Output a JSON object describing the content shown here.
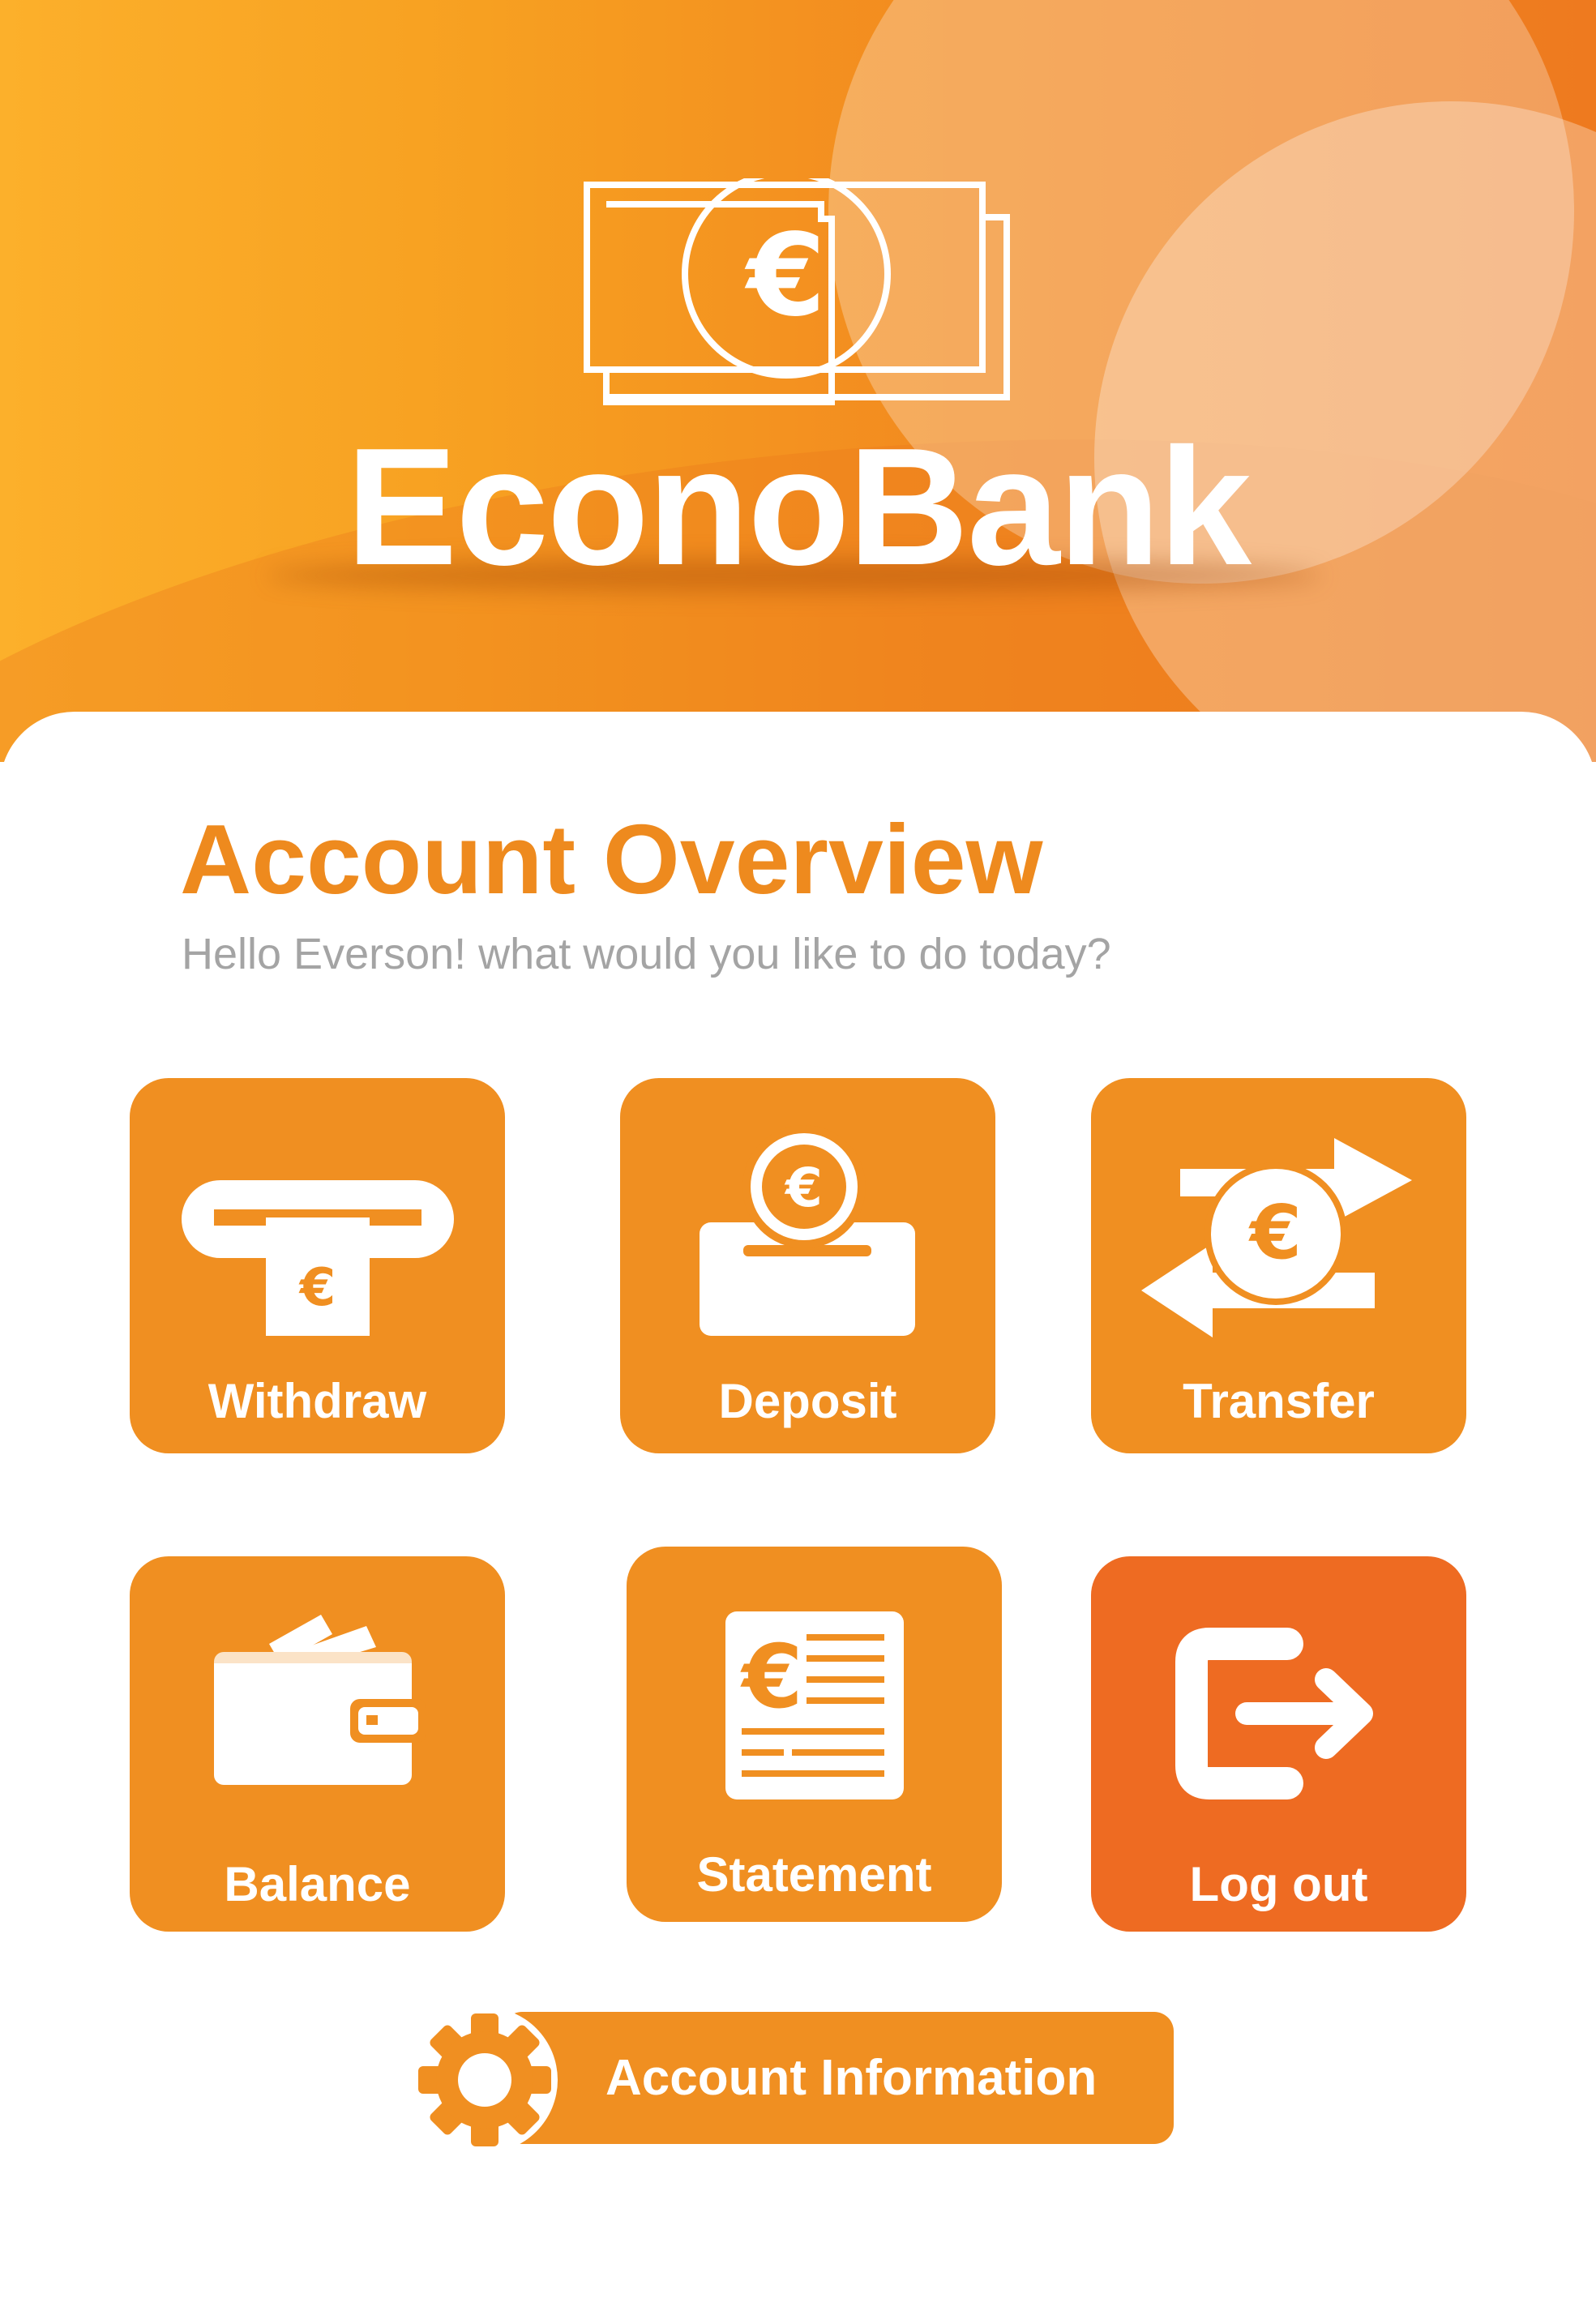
{
  "header": {
    "brand": "EconoBank",
    "logo_icon": "euro-banknote-icon"
  },
  "overview": {
    "title": "Account Overview",
    "greeting": "Hello Everson! what would you like to do today?"
  },
  "actions": [
    {
      "label": "Withdraw",
      "icon": "atm-withdraw-icon"
    },
    {
      "label": "Deposit",
      "icon": "coin-slot-deposit-icon"
    },
    {
      "label": "Transfer",
      "icon": "exchange-arrows-icon"
    },
    {
      "label": "Balance",
      "icon": "wallet-icon"
    },
    {
      "label": "Statement",
      "icon": "document-statement-icon"
    },
    {
      "label": "Log out",
      "icon": "logout-icon"
    }
  ],
  "account_button": {
    "label": "Account Information",
    "icon": "gear-icon"
  },
  "colors": {
    "accent": "#f08f21",
    "logout": "#ee6b22",
    "header_start": "#fcb02b",
    "header_end": "#ee7a1f",
    "greeting_text": "#a4a4a4"
  }
}
